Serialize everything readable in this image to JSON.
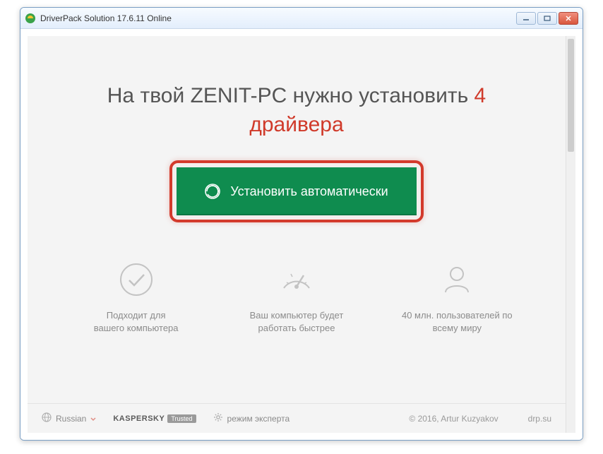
{
  "window": {
    "title": "DriverPack Solution 17.6.11 Online"
  },
  "headline": {
    "prefix": "На твой ZENIT-PC нужно установить ",
    "count": "4",
    "word": "драйвера"
  },
  "install_button": {
    "label": "Установить автоматически"
  },
  "features": [
    {
      "text_line1": "Подходит для",
      "text_line2": "вашего компьютера"
    },
    {
      "text_line1": "Ваш компьютер будет",
      "text_line2": "работать быстрее"
    },
    {
      "text_line1": "40 млн. пользователей по",
      "text_line2": "всему миру"
    }
  ],
  "footer": {
    "language": "Russian",
    "kaspersky_brand": "KASPERSKY",
    "kaspersky_trusted": "Trusted",
    "expert_mode": "режим эксперта",
    "copyright": "© 2016, Artur Kuzyakov",
    "site": "drp.su"
  }
}
